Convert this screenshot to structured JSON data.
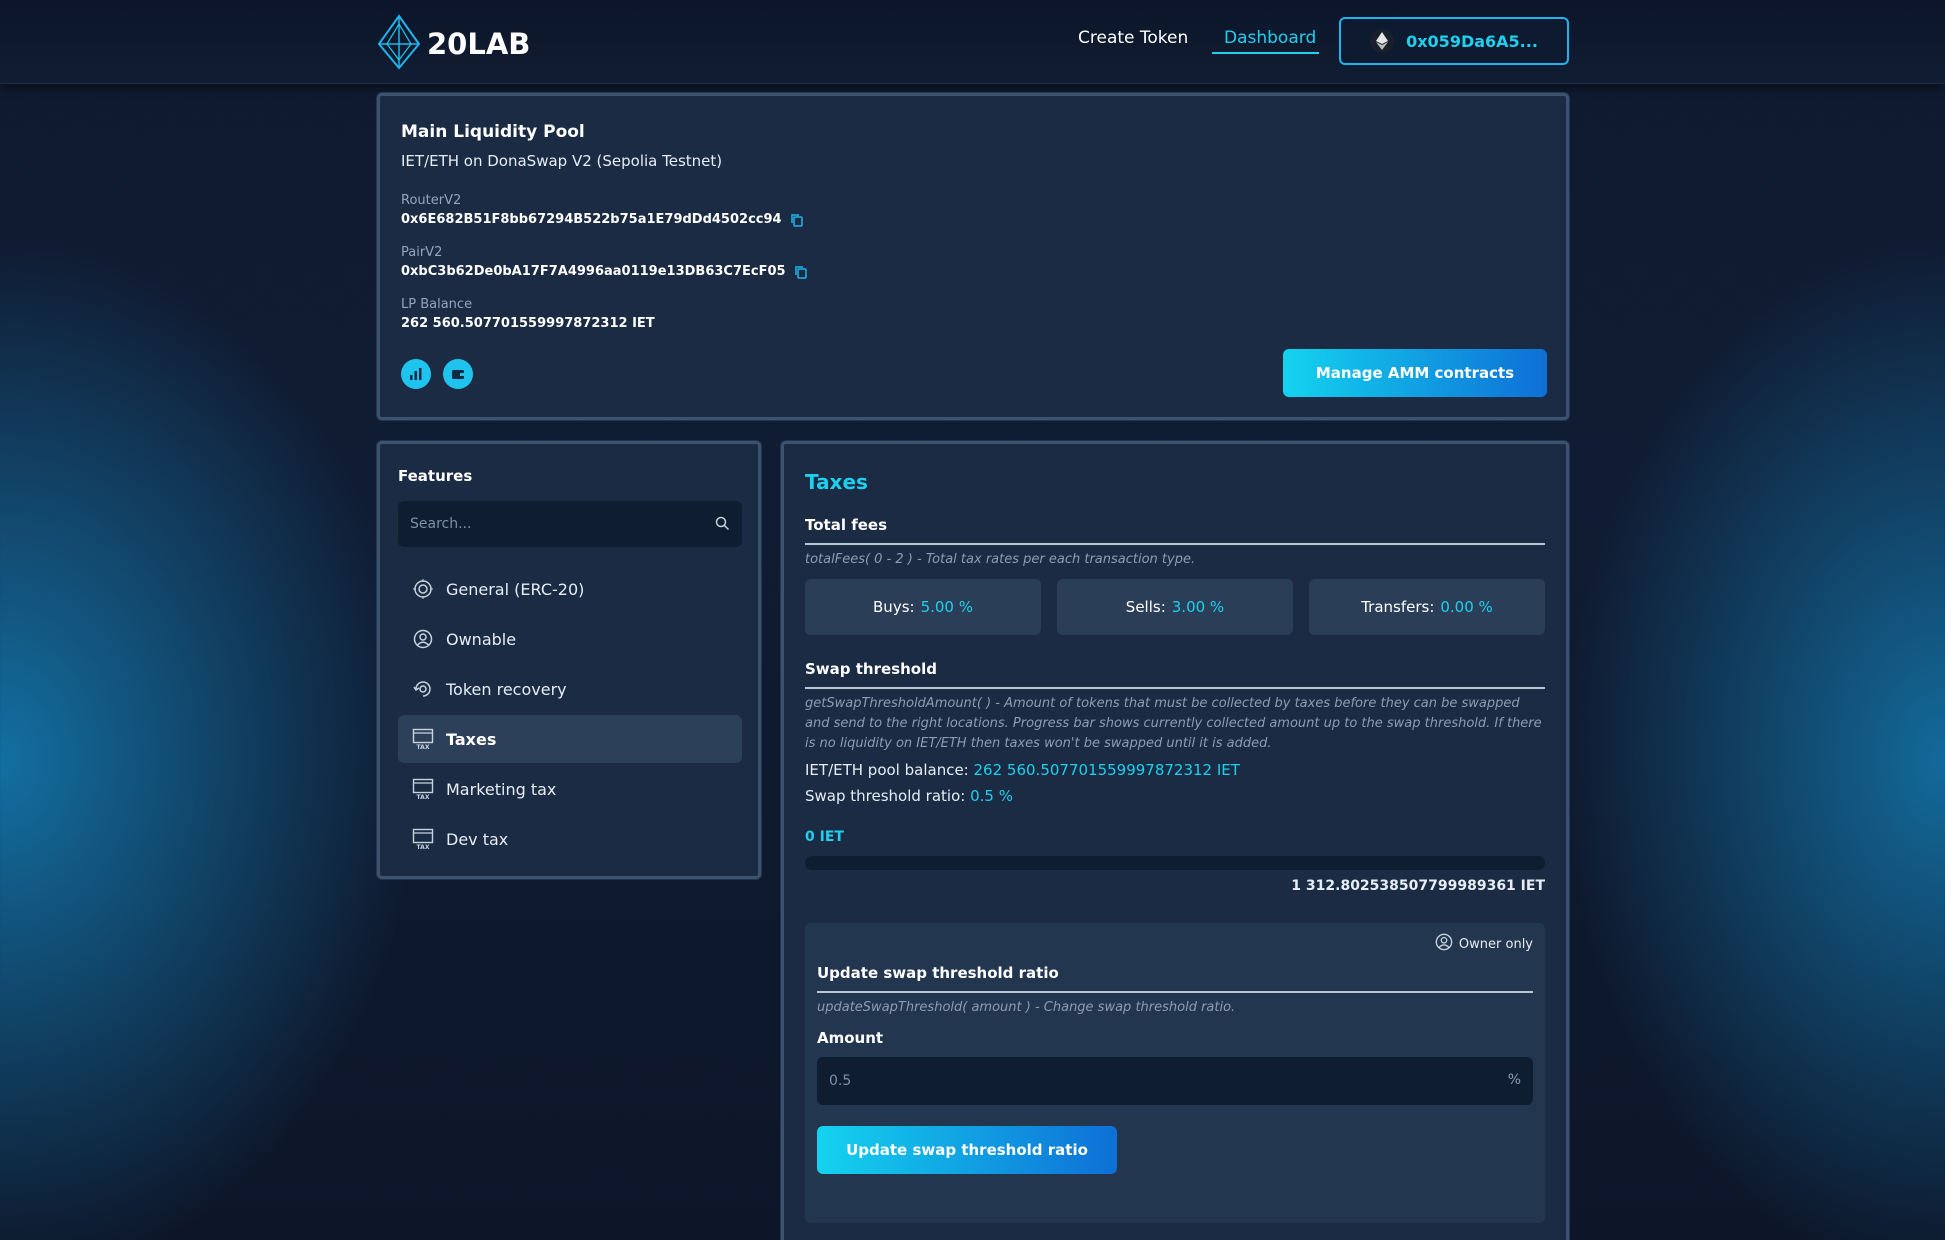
{
  "header": {
    "logo_text": "20LAB",
    "nav": {
      "create_token": "Create Token",
      "dashboard": "Dashboard"
    },
    "wallet_address": "0x059Da6A5..."
  },
  "pool": {
    "title": "Main Liquidity Pool",
    "subtitle": "IET/ETH on DonaSwap V2 (Sepolia Testnet)",
    "router_label": "RouterV2",
    "router_value": "0x6E682B51F8bb67294B522b75a1E79dDd4502cc94",
    "pair_label": "PairV2",
    "pair_value": "0xbC3b62De0bA17F7A4996aa0119e13DB63C7EcF05",
    "lp_label": "LP Balance",
    "lp_value": "262 560.507701559997872312 IET",
    "manage_button": "Manage AMM contracts"
  },
  "features": {
    "title": "Features",
    "search_placeholder": "Search...",
    "items": [
      {
        "label": "General (ERC-20)",
        "icon": "erc20-chip-icon",
        "active": false
      },
      {
        "label": "Ownable",
        "icon": "user-circle-icon",
        "active": false
      },
      {
        "label": "Token recovery",
        "icon": "recovery-icon",
        "active": false
      },
      {
        "label": "Taxes",
        "icon": "tax-icon",
        "active": true
      },
      {
        "label": "Marketing tax",
        "icon": "tax-icon",
        "active": false
      },
      {
        "label": "Dev tax",
        "icon": "tax-icon",
        "active": false
      }
    ]
  },
  "taxes": {
    "title": "Taxes",
    "total_fees": {
      "title": "Total fees",
      "description": "totalFees( 0 - 2 ) - Total tax rates per each transaction type.",
      "buys_label": "Buys:",
      "buys_value": "5.00 %",
      "sells_label": "Sells:",
      "sells_value": "3.00 %",
      "transfers_label": "Transfers:",
      "transfers_value": "0.00 %"
    },
    "swap_threshold": {
      "title": "Swap threshold",
      "description": "getSwapThresholdAmount( ) - Amount of tokens that must be collected by taxes before they can be swapped and send to the right locations. Progress bar shows currently collected amount up to the swap threshold. If there is no liquidity on IET/ETH then taxes won't be swapped until it is added.",
      "pool_balance_label": "IET/ETH pool balance:",
      "pool_balance_value": "262 560.507701559997872312 IET",
      "ratio_label": "Swap threshold ratio:",
      "ratio_value": "0.5 %",
      "collected": "0 IET",
      "progress_fraction": 0,
      "threshold_amount": "1 312.802538507799989361 IET"
    },
    "update": {
      "owner_badge": "Owner only",
      "title": "Update swap threshold ratio",
      "description": "updateSwapThreshold( amount ) - Change swap threshold ratio.",
      "amount_label": "Amount",
      "amount_placeholder": "0.5",
      "amount_unit": "%",
      "button": "Update swap threshold ratio"
    }
  },
  "colors": {
    "accent": "#1fd0ee",
    "card_bg": "#1a2b43",
    "card_border": "#3c5370",
    "gradient_start": "#14d3ef",
    "gradient_end": "#0e6fd6"
  }
}
